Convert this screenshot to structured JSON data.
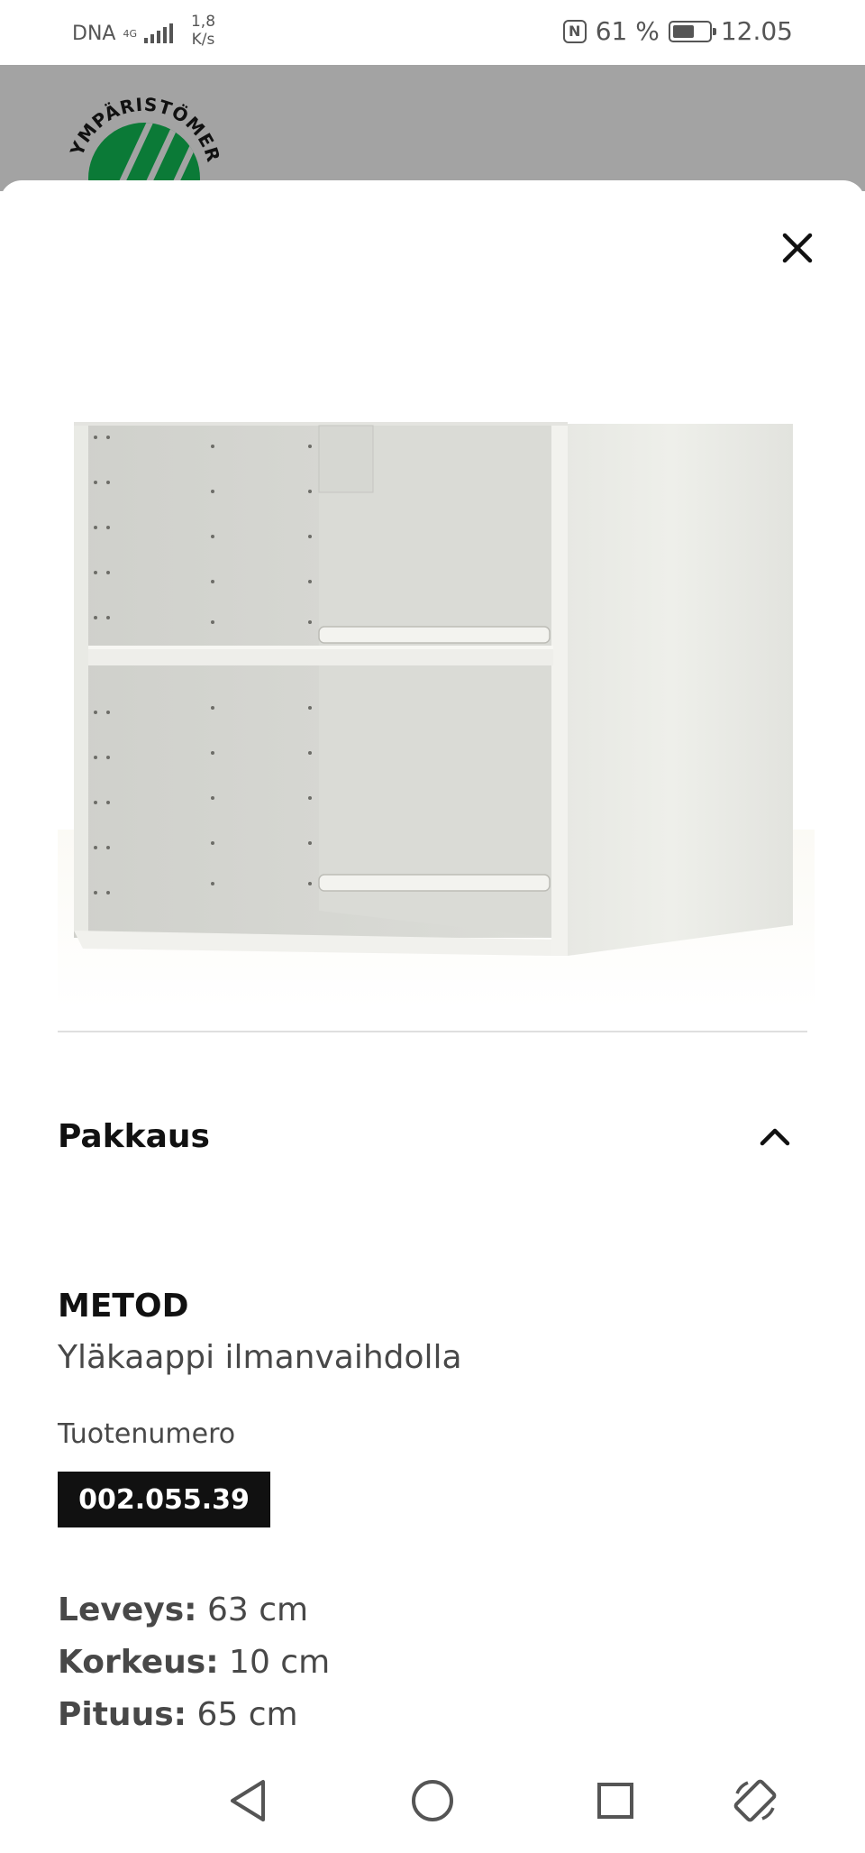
{
  "status_bar": {
    "carrier": "DNA",
    "network": "4G",
    "speed_value": "1,8",
    "speed_unit": "K/s",
    "battery": "61 %",
    "battery_level": 0.61,
    "time": "12.05",
    "icons": [
      "signal-icon",
      "nfc-icon",
      "battery-icon"
    ]
  },
  "backdrop": {
    "eco_label_text": "YMPÄRISTÖMERKKI",
    "eco_label_color": "#0b7a37"
  },
  "sheet": {
    "close_icon": "close-icon",
    "section": {
      "title": "Pakkaus",
      "expanded": true,
      "icon": "chevron-up-icon"
    },
    "product": {
      "name": "METOD",
      "description": "Yläkaappi ilmanvaihdolla",
      "number_label": "Tuotenumero",
      "number": "002.055.39"
    },
    "dimensions": [
      {
        "key": "Leveys:",
        "value": "63 cm"
      },
      {
        "key": "Korkeus:",
        "value": "10 cm"
      },
      {
        "key": "Pituus:",
        "value": "65 cm"
      }
    ]
  },
  "nav_bar": {
    "icons": [
      "back-icon",
      "home-icon",
      "recents-icon",
      "rotate-icon"
    ]
  }
}
